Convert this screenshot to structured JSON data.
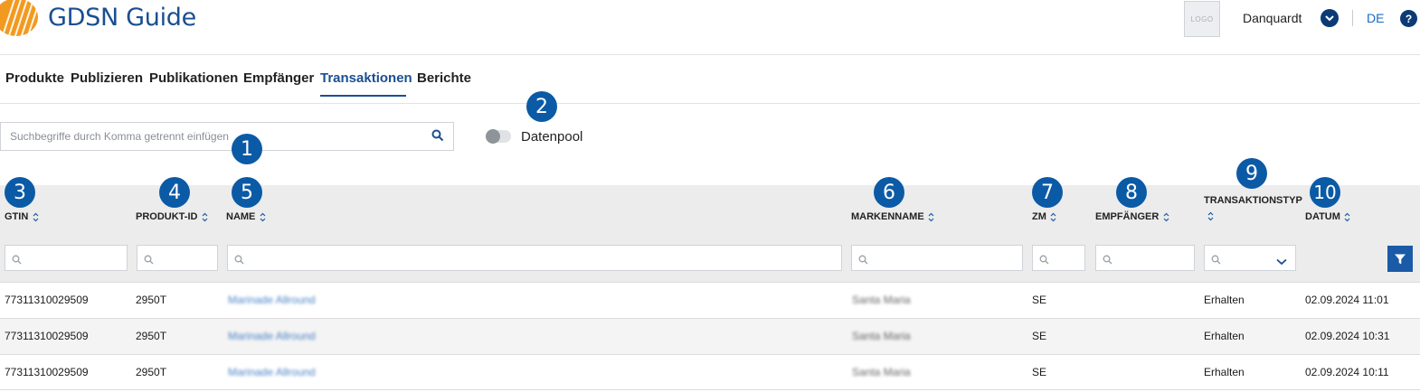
{
  "header": {
    "app_title": "GDSN Guide",
    "company_logo_text": "LOGO",
    "user_name": "Danquardt",
    "language": "DE",
    "help_label": "?"
  },
  "nav": {
    "items": [
      {
        "label": "Produkte"
      },
      {
        "label": "Publizieren"
      },
      {
        "label": "Publikationen"
      },
      {
        "label": "Empfänger"
      },
      {
        "label": "Transaktionen",
        "active": true
      },
      {
        "label": "Berichte"
      }
    ]
  },
  "search": {
    "placeholder": "Suchbegriffe durch Komma getrennt einfügen"
  },
  "datapool_toggle": {
    "label": "Datenpool",
    "on": false
  },
  "callouts": [
    "1",
    "2",
    "3",
    "4",
    "5",
    "6",
    "7",
    "8",
    "9",
    "10"
  ],
  "table": {
    "columns": [
      {
        "label": "GTIN"
      },
      {
        "label": "PRODUKT-ID"
      },
      {
        "label": "NAME"
      },
      {
        "label": "MARKENNAME"
      },
      {
        "label": "ZM"
      },
      {
        "label": "EMPFÄNGER"
      },
      {
        "label": "TRANSAKTIONSTYP"
      },
      {
        "label": "DATUM"
      }
    ],
    "rows": [
      {
        "gtin": "77311310029509",
        "produkt_id": "2950T",
        "name": "Marinade Allround",
        "markenname": "Santa Maria",
        "zm": "SE",
        "empfaenger": "",
        "transaktionstyp": "Erhalten",
        "datum": "02.09.2024 11:01"
      },
      {
        "gtin": "77311310029509",
        "produkt_id": "2950T",
        "name": "Marinade Allround",
        "markenname": "Santa Maria",
        "zm": "SE",
        "empfaenger": "",
        "transaktionstyp": "Erhalten",
        "datum": "02.09.2024 10:31"
      },
      {
        "gtin": "77311310029509",
        "produkt_id": "2950T",
        "name": "Marinade Allround",
        "markenname": "Santa Maria",
        "zm": "SE",
        "empfaenger": "",
        "transaktionstyp": "Erhalten",
        "datum": "02.09.2024 10:11"
      }
    ]
  },
  "colors": {
    "brand_blue": "#1a4f91",
    "badge_blue": "#0b5aa6",
    "logo_orange": "#f29a1f",
    "link_blue": "#4a83c7"
  }
}
